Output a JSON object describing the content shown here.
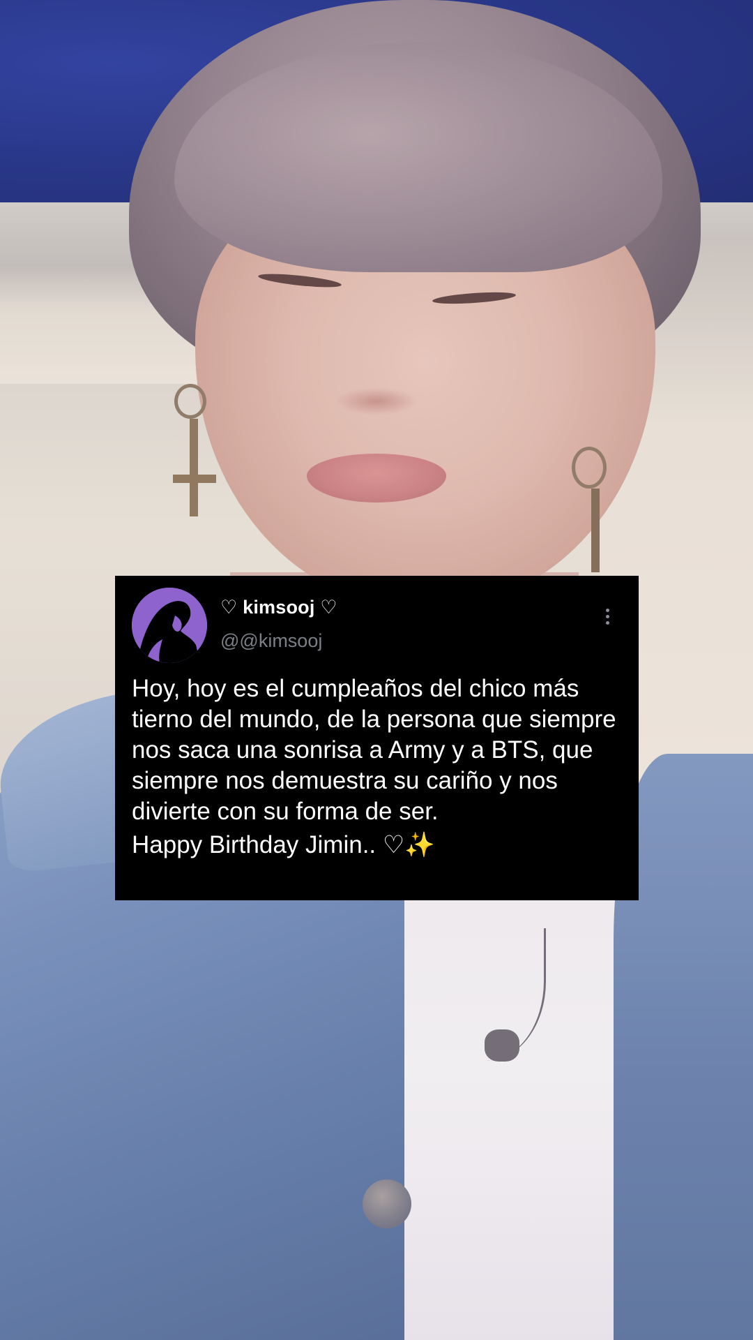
{
  "tweet": {
    "display_name": "♡ kimsooj ♡",
    "handle": "@@kimsooj",
    "text": "Hoy, hoy es el cumpleaños del chico más tierno del mundo, de la persona que siempre nos saca una sonrisa a Army y a BTS, que siempre nos demuestra su cariño y nos divierte con su forma de ser.",
    "signoff": "Happy Birthday Jimin..  ♡",
    "signoff_emoji": "✨",
    "avatar_color": "#8f63ce",
    "more_icon": "vertical-ellipsis-icon"
  }
}
